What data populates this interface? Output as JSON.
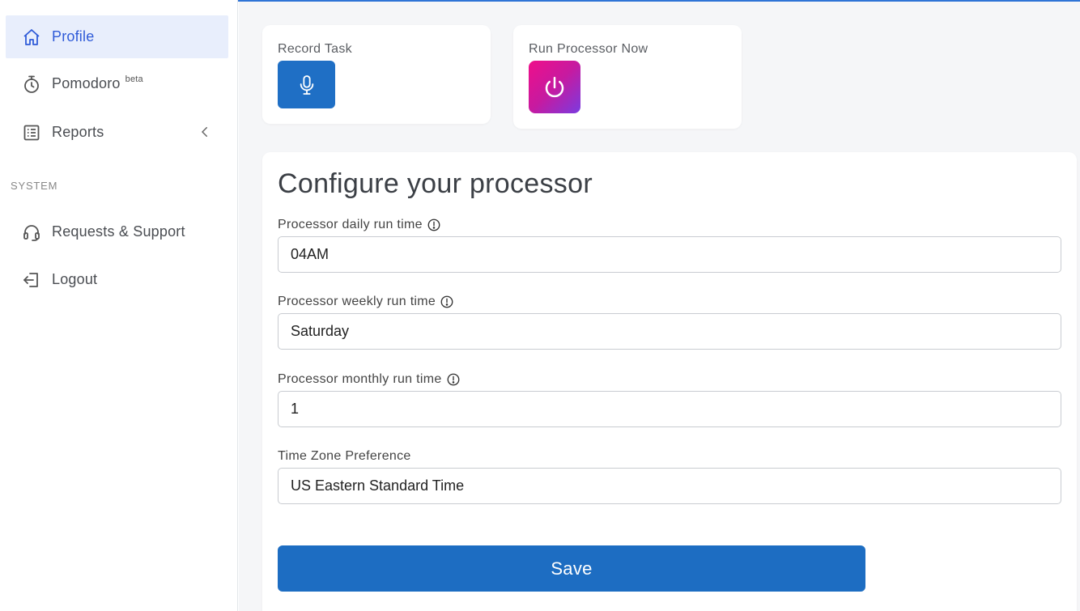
{
  "sidebar": {
    "items": [
      {
        "label": "Profile",
        "icon": "home-icon",
        "active": true
      },
      {
        "label": "Pomodoro",
        "badge": "beta",
        "icon": "stopwatch-icon"
      },
      {
        "label": "Reports",
        "icon": "list-icon"
      }
    ],
    "section_label": "SYSTEM",
    "system_items": [
      {
        "label": "Requests & Support",
        "icon": "headset-icon"
      },
      {
        "label": "Logout",
        "icon": "logout-icon"
      }
    ]
  },
  "actions": {
    "record_title": "Record Task",
    "record_icon": "microphone-icon",
    "run_title": "Run Processor Now",
    "run_icon": "power-icon"
  },
  "config": {
    "title": "Configure your processor",
    "fields": [
      {
        "label": "Processor daily run time",
        "value": "04AM",
        "info": true
      },
      {
        "label": "Processor weekly run time",
        "value": "Saturday",
        "info": true
      },
      {
        "label": "Processor monthly run time",
        "value": "1",
        "info": true
      },
      {
        "label": "Time Zone Preference",
        "value": "US Eastern Standard Time",
        "info": false
      }
    ],
    "save_label": "Save"
  },
  "colors": {
    "accent": "#1d6dc2",
    "active_nav_bg": "#e8eefc",
    "active_nav_text": "#2f5bd8",
    "run_gradient_start": "#ef0f8a",
    "run_gradient_end": "#7a3be0"
  }
}
